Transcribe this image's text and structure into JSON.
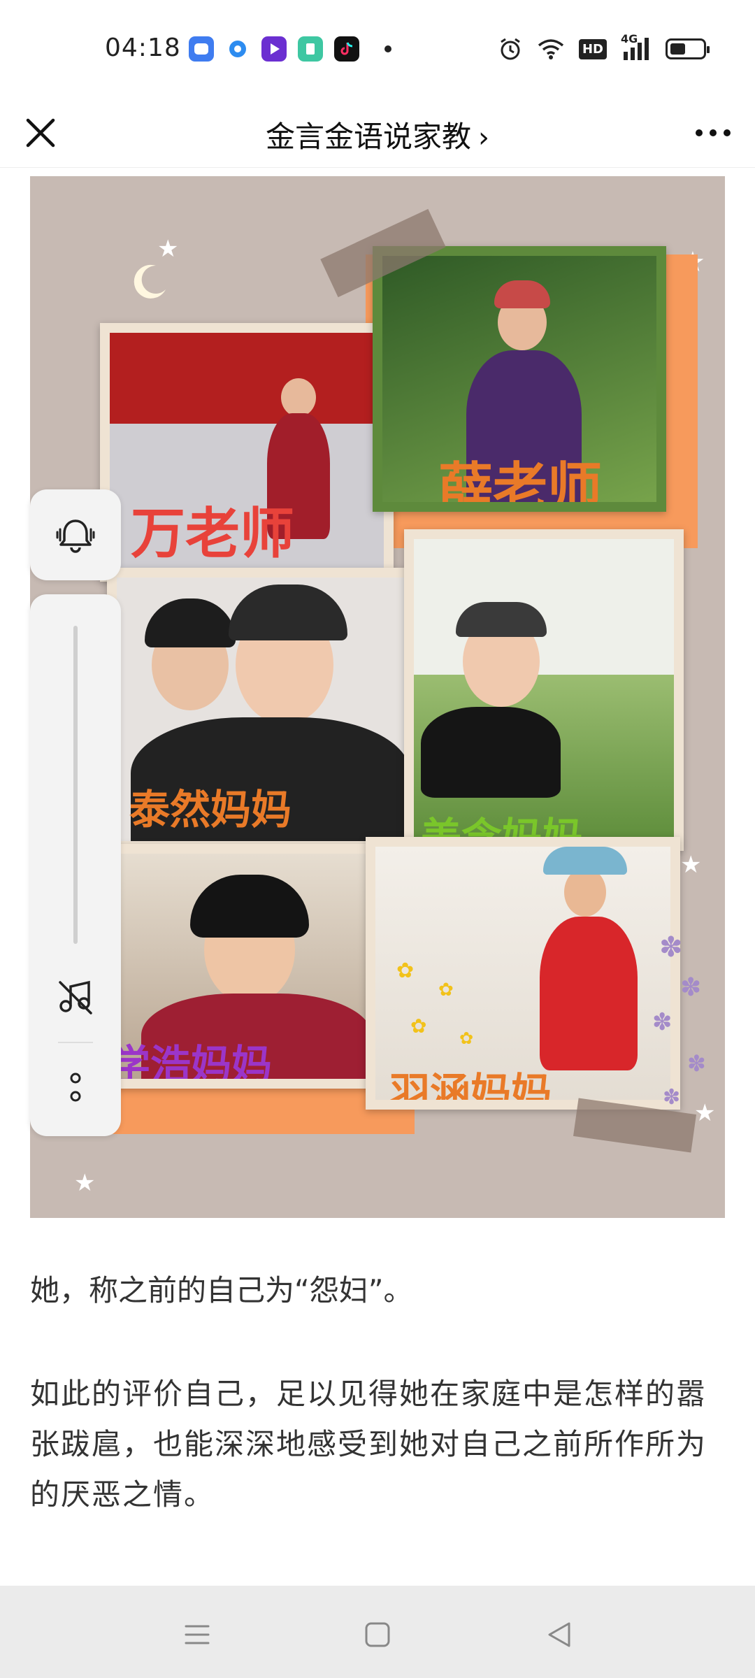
{
  "status_bar": {
    "time": "04:18",
    "hd_label": "HD",
    "network_label": "4G",
    "icons": [
      "alarm-icon",
      "wifi-icon",
      "hd-icon",
      "signal-icon",
      "battery-icon"
    ],
    "app_icons": [
      "app-icon-blue",
      "app-icon-circle",
      "app-icon-video",
      "app-icon-green",
      "tiktok-icon"
    ]
  },
  "nav": {
    "title": "金言金语说家教",
    "chevron": "›"
  },
  "image": {
    "labels": {
      "wan": "万老师",
      "xue": "薛老师",
      "tairan": "泰然妈妈",
      "meihan": "美含妈妈",
      "xuehao": "学浩妈妈",
      "yuhan": "羽涵妈妈"
    }
  },
  "article": {
    "paragraph_1": "她，称之前的自己为“怨妇”。",
    "paragraph_2": "如此的评价自己，足以见得她在家庭中是怎样的嚣张跋扈，也能深深地感受到她对自己之前所作所为的厌恶之情。"
  },
  "colors": {
    "image_bg": "#c7bab3",
    "accent_orange": "#f79a5c",
    "label_red": "#e8423a",
    "label_orange": "#e97a28",
    "label_green": "#7ac62a",
    "label_purple": "#9b35c9"
  }
}
